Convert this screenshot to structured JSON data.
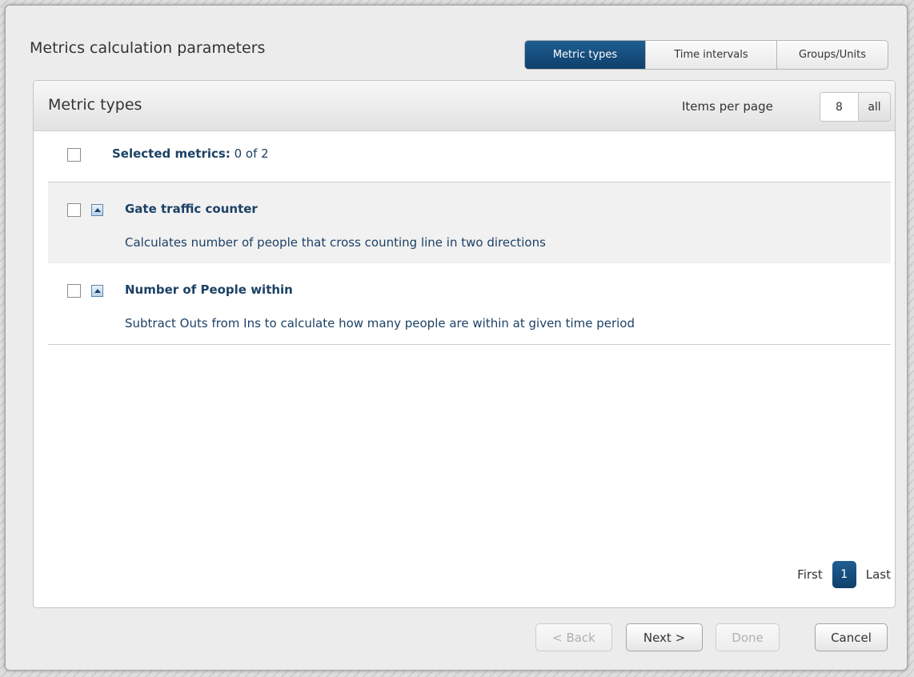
{
  "dialog": {
    "title": "Metrics calculation parameters",
    "tabs": [
      {
        "label": "Metric types",
        "active": true
      },
      {
        "label": "Time intervals",
        "active": false
      },
      {
        "label": "Groups/Units",
        "active": false
      }
    ]
  },
  "panel": {
    "title": "Metric types",
    "items_per_page_label": "Items per page",
    "items_per_page_value": "8",
    "all_label": "all"
  },
  "selection": {
    "label": "Selected metrics:",
    "count_text": "0 of 2",
    "checked": false
  },
  "metrics": [
    {
      "name": "Gate traffic counter",
      "description": "Calculates number of people that cross counting line in two directions",
      "checked": false
    },
    {
      "name": "Number of People within",
      "description": "Subtract Outs from Ins to calculate how many people are within at given time period",
      "checked": false
    }
  ],
  "pagination": {
    "first_label": "First",
    "current_page": "1",
    "last_label": "Last"
  },
  "footer": {
    "back_label": "< Back",
    "next_label": "Next >",
    "done_label": "Done",
    "cancel_label": "Cancel"
  },
  "colors": {
    "accent": "#184d7c",
    "metric_text": "#1c4165",
    "shaded_row": "#f1f1f1"
  }
}
